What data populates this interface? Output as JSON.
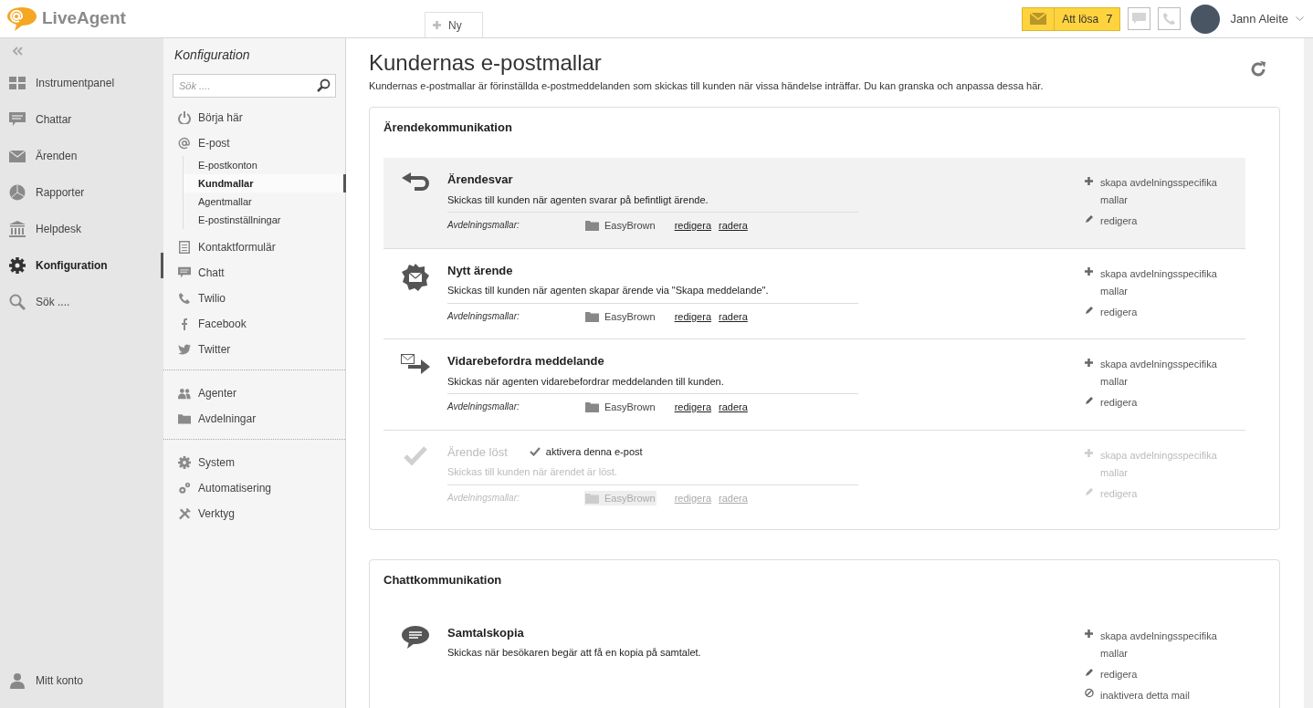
{
  "header": {
    "logo": "LiveAgent",
    "new_button": "Ny",
    "to_solve": {
      "label": "Att lösa",
      "count": "7"
    },
    "user": "Jann Aleite"
  },
  "main_nav": {
    "items": [
      {
        "label": "Instrumentpanel",
        "kind": "dashboard",
        "selected": false
      },
      {
        "label": "Chattar",
        "kind": "chat",
        "selected": false
      },
      {
        "label": "Ärenden",
        "kind": "mail",
        "selected": false
      },
      {
        "label": "Rapporter",
        "kind": "pie",
        "selected": false
      },
      {
        "label": "Helpdesk",
        "kind": "bank",
        "selected": false
      },
      {
        "label": "Konfiguration",
        "kind": "gear",
        "selected": true
      },
      {
        "label": "Sök ....",
        "kind": "search",
        "selected": false
      }
    ],
    "account": "Mitt konto"
  },
  "config_panel": {
    "title": "Konfiguration",
    "search": {
      "placeholder": "Sök ...."
    },
    "groups": [
      [
        {
          "label": "Börja här",
          "kind": "power"
        },
        {
          "label": "E-post",
          "kind": "at",
          "children": [
            {
              "label": "E-postkonton",
              "selected": false
            },
            {
              "label": "Kundmallar",
              "selected": true
            },
            {
              "label": "Agentmallar",
              "selected": false
            },
            {
              "label": "E-postinställningar",
              "selected": false
            }
          ]
        },
        {
          "label": "Kontaktformulär",
          "kind": "form"
        },
        {
          "label": "Chatt",
          "kind": "chat"
        },
        {
          "label": "Twilio",
          "kind": "phone"
        },
        {
          "label": "Facebook",
          "kind": "facebook"
        },
        {
          "label": "Twitter",
          "kind": "bird"
        }
      ],
      [
        {
          "label": "Agenter",
          "kind": "people"
        },
        {
          "label": "Avdelningar",
          "kind": "folder"
        }
      ],
      [
        {
          "label": "System",
          "kind": "gear"
        },
        {
          "label": "Automatisering",
          "kind": "gears"
        },
        {
          "label": "Verktyg",
          "kind": "tools"
        }
      ]
    ]
  },
  "content": {
    "title": "Kundernas e-postmallar",
    "description": "Kundernas e-postmallar är förinställda e-postmeddelanden som skickas till kunden när vissa händelse inträffar. Du kan granska och anpassa dessa här.",
    "sections": [
      {
        "title": "Ärendekommunikation",
        "templates": [
          {
            "name": "Ärendesvar",
            "kind": "reply",
            "enabled": true,
            "selected": true,
            "description": "Skickas till kunden när agenten svarar på befintligt ärende.",
            "dept_label": "Avdelningsmallar:",
            "departments": [
              {
                "name": "EasyBrown",
                "edit": "redigera",
                "delete": "radera"
              }
            ],
            "actions": [
              {
                "kind": "create",
                "label": "skapa avdelningsspecifika mallar"
              },
              {
                "kind": "edit",
                "label": "redigera"
              }
            ]
          },
          {
            "name": "Nytt ärende",
            "kind": "new-mail",
            "enabled": true,
            "selected": false,
            "description": "Skickas till kunden när agenten skapar ärende via \"Skapa meddelande\".",
            "dept_label": "Avdelningsmallar:",
            "departments": [
              {
                "name": "EasyBrown",
                "edit": "redigera",
                "delete": "radera"
              }
            ],
            "actions": [
              {
                "kind": "create",
                "label": "skapa avdelningsspecifika mallar"
              },
              {
                "kind": "edit",
                "label": "redigera"
              }
            ]
          },
          {
            "name": "Vidarebefordra meddelande",
            "kind": "forward",
            "enabled": true,
            "selected": false,
            "description": "Skickas när agenten vidarebefordrar meddelanden till kunden.",
            "dept_label": "Avdelningsmallar:",
            "departments": [
              {
                "name": "EasyBrown",
                "edit": "redigera",
                "delete": "radera"
              }
            ],
            "actions": [
              {
                "kind": "create",
                "label": "skapa avdelningsspecifika mallar"
              },
              {
                "kind": "edit",
                "label": "redigera"
              }
            ]
          },
          {
            "name": "Ärende löst",
            "kind": "check",
            "enabled": false,
            "selected": false,
            "activate": "aktivera denna e-post",
            "description": "Skickas till kunden när ärendet är löst.",
            "dept_label": "Avdelningsmallar:",
            "departments": [
              {
                "name": "EasyBrown",
                "edit": "redigera",
                "delete": "radera"
              }
            ],
            "actions": [
              {
                "kind": "create",
                "label": "skapa avdelningsspecifika mallar"
              },
              {
                "kind": "edit",
                "label": "redigera"
              }
            ]
          }
        ]
      },
      {
        "title": "Chattkommunikation",
        "templates": [
          {
            "name": "Samtalskopia",
            "kind": "chat",
            "enabled": true,
            "selected": false,
            "description": "Skickas när besökaren begär att få en kopia på samtalet.",
            "actions": [
              {
                "kind": "create",
                "label": "skapa avdelningsspecifika mallar"
              },
              {
                "kind": "edit",
                "label": "redigera"
              },
              {
                "kind": "deactivate",
                "label": "inaktivera detta mail"
              }
            ]
          }
        ]
      }
    ]
  }
}
